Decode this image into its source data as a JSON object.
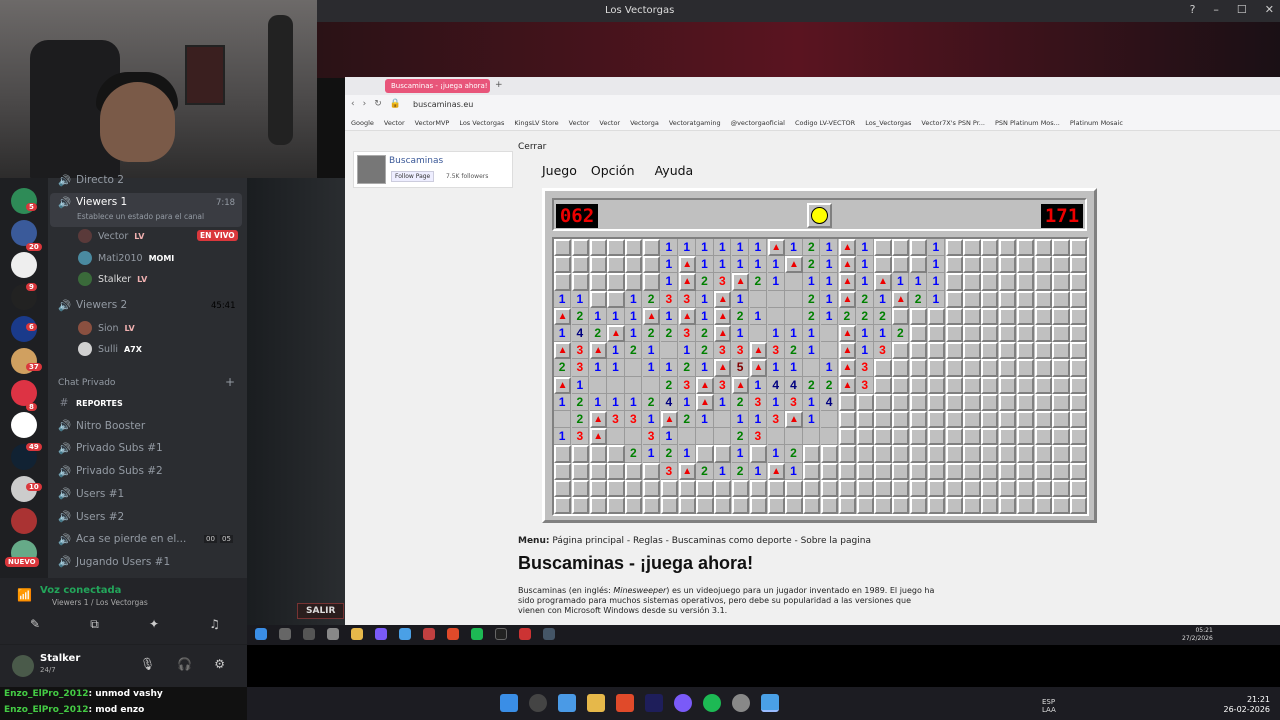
{
  "window": {
    "title": "Los Vectorgas"
  },
  "discord": {
    "channels": {
      "directo2": "Directo 2",
      "viewers1": {
        "name": "Viewers 1",
        "time": "7:18",
        "status": "Establece un estado para el canal"
      },
      "viewers1_users": [
        {
          "name": "Vector",
          "tag": "LV",
          "live": "EN VIVO",
          "color": "#5a3a3a"
        },
        {
          "name": "Mati2010",
          "tag": "MOMI",
          "color": "#4a8aa0"
        },
        {
          "name": "Stalker",
          "tag": "LV",
          "color": "#3a6a3a"
        }
      ],
      "viewers2": {
        "name": "Viewers 2",
        "time": "45:41"
      },
      "viewers2_users": [
        {
          "name": "Sion",
          "tag": "LV",
          "color": "#8a5040"
        },
        {
          "name": "Sulli",
          "tag": "A7X",
          "color": "#d0d0d0"
        }
      ],
      "category": "Chat Privado",
      "list": [
        {
          "name": "REPORTES",
          "icon": "#"
        },
        {
          "name": "Nitro Booster",
          "icon": "speaker"
        },
        {
          "name": "Privado Subs #1",
          "icon": "speaker"
        },
        {
          "name": "Privado Subs #2",
          "icon": "speaker"
        },
        {
          "name": "Users #1",
          "icon": "speaker"
        },
        {
          "name": "Users #2",
          "icon": "speaker"
        },
        {
          "name": "Aca se pierde en el...",
          "icon": "speaker",
          "count1": "00",
          "count2": "05"
        },
        {
          "name": "Jugando Users #1",
          "icon": "speaker"
        }
      ]
    },
    "voice": {
      "status": "Voz conectada",
      "channel": "Viewers 1 / Los Vectorgas"
    },
    "user": {
      "name": "Stalker",
      "status": "24/7"
    },
    "servers_badges": [
      "5",
      "20",
      "9",
      "6",
      "37",
      "8",
      "49",
      "10"
    ],
    "new_label": "NUEVO",
    "chat": [
      {
        "user": "Enzo_ElPro_2012",
        "msg": ": unmod vashy"
      },
      {
        "user": "Enzo_ElPro_2012",
        "msg": ": mod enzo"
      }
    ],
    "salir": "SALIR"
  },
  "browser": {
    "tab": "Buscaminas - ¡juega ahora!",
    "url": "buscaminas.eu",
    "bookmarks": [
      "Google",
      "Vector",
      "VectorMVP",
      "Los Vectorgas",
      "KingsLV Store",
      "Vector",
      "Vector",
      "Vectorga",
      "Vectoratgaming",
      "@vectorgaoficial",
      "Codigo LV-VECTOR",
      "Los_Vectorgas",
      "Vector7X's PSN Pr...",
      "PSN Platinum Mos...",
      "Platinum Mosaic"
    ],
    "close_label": "Cerrar",
    "fb": {
      "name": "Buscaminas",
      "follow": "Follow Page",
      "followers": "7.5K followers"
    },
    "menu": [
      "Juego",
      "Opción",
      "Ayuda"
    ],
    "mines_left": "062",
    "timer": "171",
    "page_menu_label": "Menu:",
    "page_menu": "Página principal - Reglas - Buscaminas como deporte - Sobre la pagina",
    "heading": "Buscaminas - ¡juega ahora!",
    "desc_a": "Buscaminas (en inglés: ",
    "desc_em": "Minesweeper",
    "desc_b": ") es un videojuego para un jugador inventado en 1989. El juego ha sido programado para muchos sistemas operativos, pero debe su popularidad a las versiones que vienen con Microsoft Windows desde su versión 3.1."
  },
  "board": {
    "cols": 30,
    "rows": 16,
    "rows_data": [
      "......111111F121F1...1........",
      "......1F11111F21F1...1........",
      "......1F23F21.11F1F111........",
      "11..12331F1...21F21F21........",
      "F2111F1F1F21..21222...........",
      "142F12232F1.111.F112..........",
      "F3F121.1233F321.F13...........",
      "2311.1121F5F11.1F3............",
      "F1....23F3F14422F3............",
      "12111241F1231314..............",
      ".2F331F21.113F1...............",
      "13F..31...23..................",
      "....2121..1.12................",
      "......3F2121F1................",
      "..............................",
      ".............................."
    ],
    "colors": {
      "1": "#0000ff",
      "2": "#008000",
      "3": "#ff0000",
      "4": "#000080",
      "5": "#800000"
    }
  },
  "tray": {
    "lang": "ESP",
    "lang2": "LAA",
    "time": "21:21",
    "date": "26-02-2026",
    "inner_time": "05:21",
    "inner_date": "27/2/2026"
  }
}
